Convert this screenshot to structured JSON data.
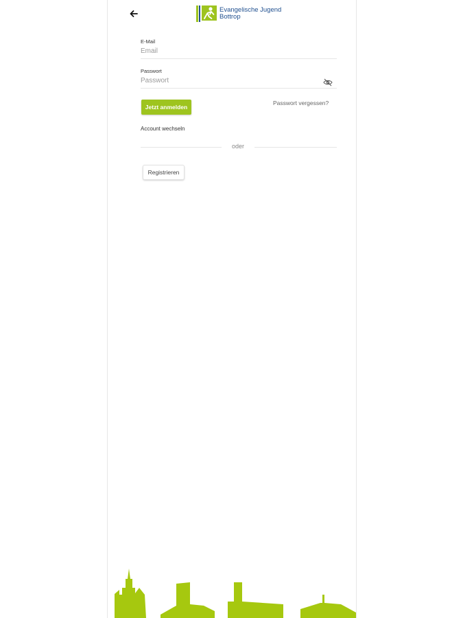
{
  "header": {
    "back_icon": "arrow-left-icon",
    "logo": {
      "line1": "Evangelische Jugend",
      "line2": "Bottrop"
    }
  },
  "form": {
    "email": {
      "label": "E-Mail",
      "placeholder": "Email",
      "value": ""
    },
    "password": {
      "label": "Passwort",
      "placeholder": "Passwort",
      "value": "",
      "toggle_icon": "eye-off-icon"
    },
    "login_label": "Jetzt anmelden",
    "forgot_label": "Passwort vergessen?",
    "switch_account_label": "Account wechseln",
    "divider_text": "oder",
    "register_label": "Registrieren"
  },
  "colors": {
    "accent": "#9ec41f",
    "logo_blue": "#1f4f8f",
    "background": "#ffffff",
    "skyline": "#a6c80f"
  },
  "footer": {
    "skyline_icon": "city-skyline-illustration"
  }
}
